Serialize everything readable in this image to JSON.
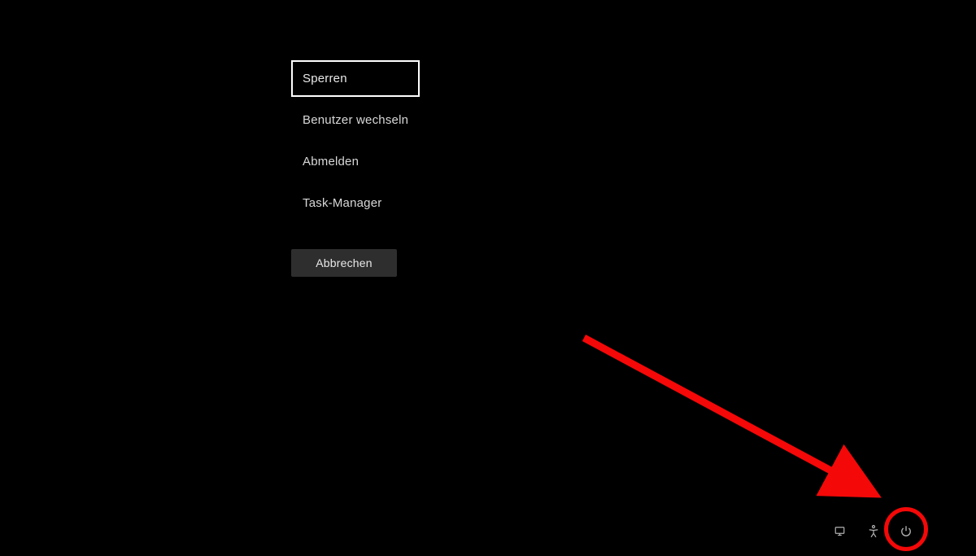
{
  "menu": {
    "items": [
      {
        "label": "Sperren",
        "selected": true
      },
      {
        "label": "Benutzer wechseln",
        "selected": false
      },
      {
        "label": "Abmelden",
        "selected": false
      },
      {
        "label": "Task-Manager",
        "selected": false
      }
    ],
    "cancel_label": "Abbrechen"
  },
  "bottom_icons": {
    "network": "network-icon",
    "accessibility": "accessibility-icon",
    "power": "power-icon"
  },
  "annotation": {
    "colors": {
      "highlight": "#f40808"
    }
  }
}
